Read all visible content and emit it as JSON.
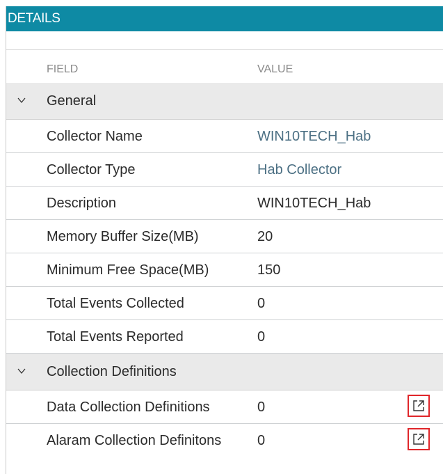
{
  "panel": {
    "title": "DETAILS"
  },
  "columns": {
    "field": "FIELD",
    "value": "VALUE"
  },
  "groups": [
    {
      "label": "General",
      "rows": [
        {
          "field": "Collector Name",
          "value": "WIN10TECH_Hab",
          "value_is_link": true
        },
        {
          "field": "Collector Type",
          "value": "Hab Collector",
          "value_is_link": true
        },
        {
          "field": "Description",
          "value": "WIN10TECH_Hab"
        },
        {
          "field": "Memory Buffer Size(MB)",
          "value": "20"
        },
        {
          "field": "Minimum Free Space(MB)",
          "value": "150"
        },
        {
          "field": "Total Events Collected",
          "value": "0"
        },
        {
          "field": "Total Events Reported",
          "value": "0"
        }
      ]
    },
    {
      "label": "Collection Definitions",
      "rows": [
        {
          "field": "Data Collection Definitions",
          "value": "0",
          "action_icon": "external-link-icon"
        },
        {
          "field": "Alaram Collection Definitons",
          "value": "0",
          "action_icon": "external-link-icon"
        }
      ]
    }
  ],
  "colors": {
    "titlebar": "#0e8aa4",
    "group_background": "#eaeaea",
    "link_value": "#4c7084",
    "highlight_border": "#e0262a"
  }
}
